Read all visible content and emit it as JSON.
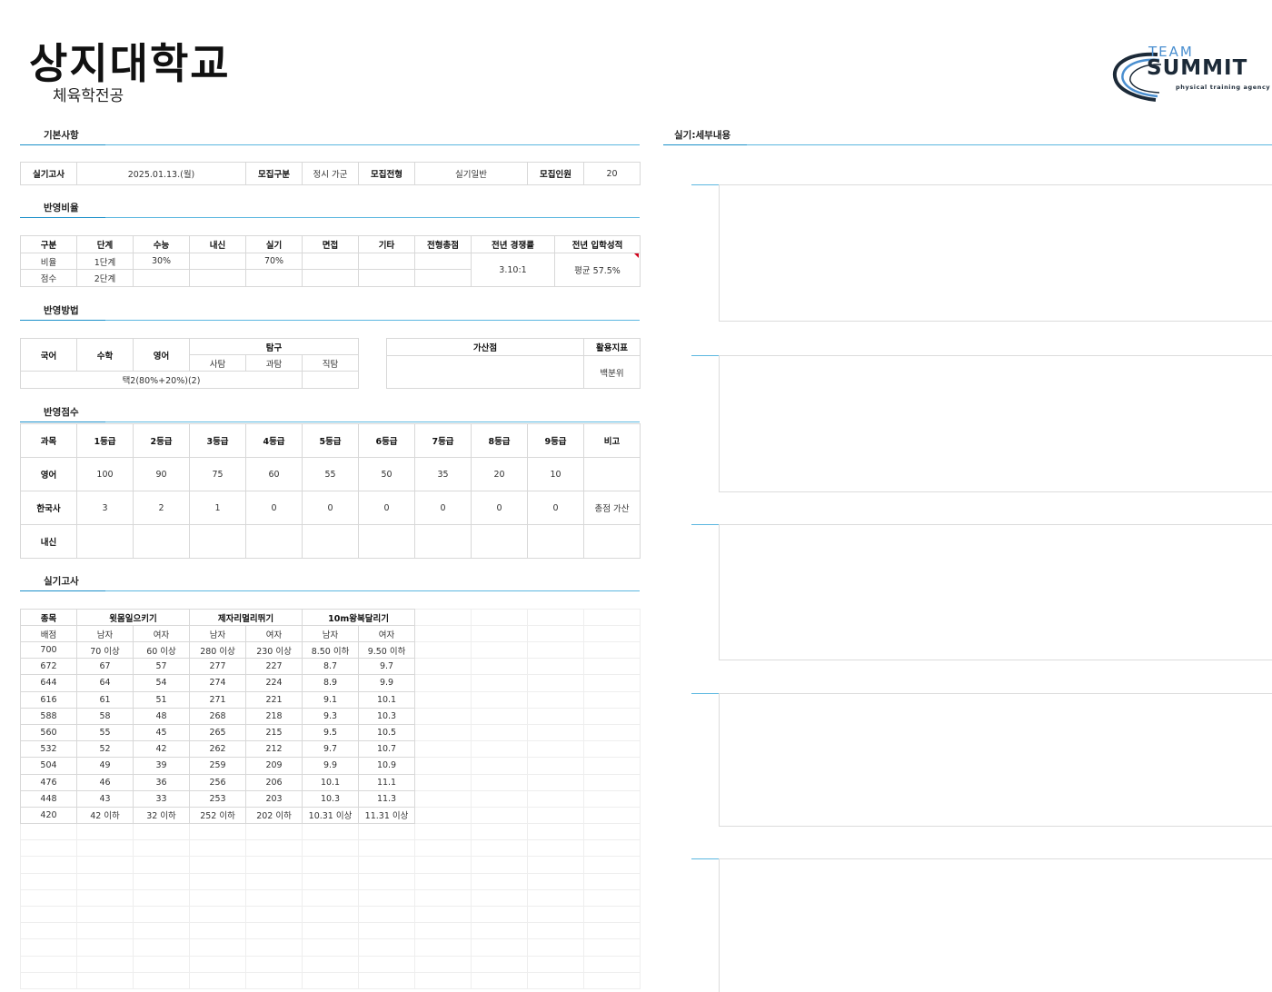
{
  "header": {
    "university": "상지대학교",
    "department": "체육학전공",
    "logo": {
      "team": "TEAM",
      "summit": "SUMMIT",
      "tagline": "physical training agency",
      "accent": "#4a8fd0"
    }
  },
  "sections": {
    "basic": "기본사항",
    "ratio": "반영비율",
    "method": "반영방법",
    "score": "반영점수",
    "practical": "실기고사",
    "detail": "실기:세부내용"
  },
  "basic": {
    "exam_label": "실기고사",
    "exam_date": "2025.01.13.(월)",
    "type_label": "모집구분",
    "type_value": "정시 가군",
    "track_label": "모집전형",
    "track_value": "실기일반",
    "quota_label": "모집인원",
    "quota_value": "20"
  },
  "ratio": {
    "headers": [
      "구분",
      "단계",
      "수능",
      "내신",
      "실기",
      "면접",
      "기타",
      "전형총점",
      "전년 경쟁률",
      "전년 입학성적"
    ],
    "row1": [
      "비율",
      "1단계",
      "30%",
      "",
      "70%",
      "",
      "",
      ""
    ],
    "row2": [
      "점수",
      "2단계",
      "",
      "",
      "",
      "",
      "",
      ""
    ],
    "prev_competition": "3.10:1",
    "prev_score": "평균 57.5%"
  },
  "method": {
    "korean": "국어",
    "math": "수학",
    "english": "영어",
    "inquiry": "탐구",
    "social": "사탐",
    "science": "과탐",
    "vocational": "직탐",
    "formula": "택2(80%+20%)(2)",
    "bonus": "가산점",
    "index": "활용지표",
    "index_value": "백분위"
  },
  "score": {
    "headers": [
      "과목",
      "1등급",
      "2등급",
      "3등급",
      "4등급",
      "5등급",
      "6등급",
      "7등급",
      "8등급",
      "9등급",
      "비고"
    ],
    "rows": [
      [
        "영어",
        "100",
        "90",
        "75",
        "60",
        "55",
        "50",
        "35",
        "20",
        "10",
        ""
      ],
      [
        "한국사",
        "3",
        "2",
        "1",
        "0",
        "0",
        "0",
        "0",
        "0",
        "0",
        "총점 가산"
      ],
      [
        "내신",
        "",
        "",
        "",
        "",
        "",
        "",
        "",
        "",
        "",
        ""
      ]
    ]
  },
  "practical": {
    "event_label": "종목",
    "points_label": "배점",
    "events": [
      "윗몸일으키기",
      "제자리멀리뛰기",
      "10m왕복달리기"
    ],
    "sexes": [
      "남자",
      "여자",
      "남자",
      "여자",
      "남자",
      "여자"
    ],
    "rows": [
      [
        "700",
        "70 이상",
        "60 이상",
        "280 이상",
        "230 이상",
        "8.50 이하",
        "9.50 이하"
      ],
      [
        "672",
        "67",
        "57",
        "277",
        "227",
        "8.7",
        "9.7"
      ],
      [
        "644",
        "64",
        "54",
        "274",
        "224",
        "8.9",
        "9.9"
      ],
      [
        "616",
        "61",
        "51",
        "271",
        "221",
        "9.1",
        "10.1"
      ],
      [
        "588",
        "58",
        "48",
        "268",
        "218",
        "9.3",
        "10.3"
      ],
      [
        "560",
        "55",
        "45",
        "265",
        "215",
        "9.5",
        "10.5"
      ],
      [
        "532",
        "52",
        "42",
        "262",
        "212",
        "9.7",
        "10.7"
      ],
      [
        "504",
        "49",
        "39",
        "259",
        "209",
        "9.9",
        "10.9"
      ],
      [
        "476",
        "46",
        "36",
        "256",
        "206",
        "10.1",
        "11.1"
      ],
      [
        "448",
        "43",
        "33",
        "253",
        "203",
        "10.3",
        "11.3"
      ],
      [
        "420",
        "42 이하",
        "32 이하",
        "252 이하",
        "202 이하",
        "10.31 이상",
        "11.31 이상"
      ]
    ]
  },
  "colors": {
    "section_line": "#5bb7e0",
    "section_line_dark": "#1a8fc9",
    "grid": "#d8d8d8",
    "comment_marker": "#d0021b"
  }
}
